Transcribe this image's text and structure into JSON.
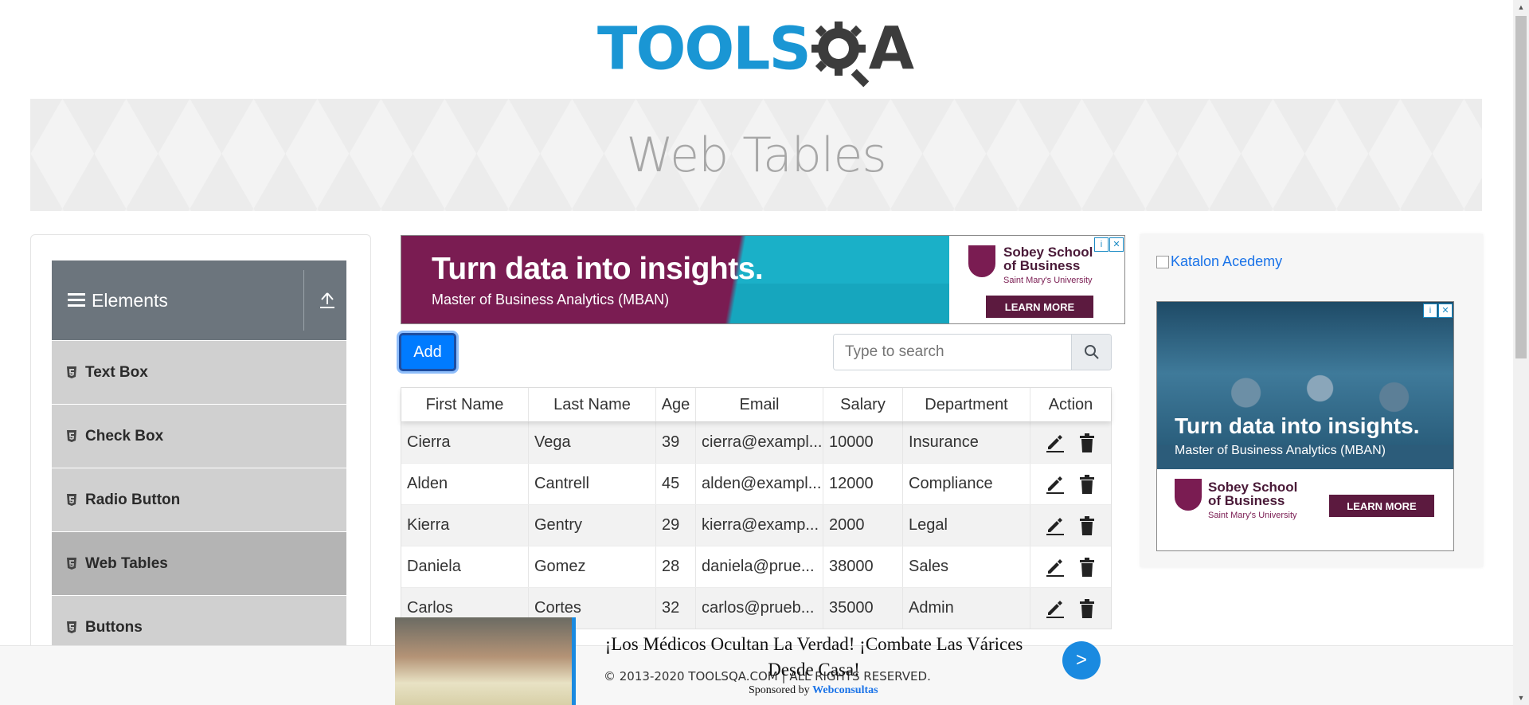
{
  "logo": {
    "part1": "TOOLS",
    "part2": "A"
  },
  "banner": {
    "title": "Web Tables"
  },
  "sidebar": {
    "group_title": "Elements",
    "items": [
      {
        "label": "Text Box"
      },
      {
        "label": "Check Box"
      },
      {
        "label": "Radio Button"
      },
      {
        "label": "Web Tables"
      },
      {
        "label": "Buttons"
      }
    ]
  },
  "ad_top": {
    "headline": "Turn data into insights.",
    "subline": "Master of Business Analytics (MBAN)",
    "brand_line1": "Sobey School",
    "brand_line2": "of Business",
    "brand_uni": "Saint Mary's University",
    "cta": "LEARN MORE"
  },
  "controls": {
    "add_label": "Add",
    "search_placeholder": "Type to search"
  },
  "table": {
    "headers": [
      "First Name",
      "Last Name",
      "Age",
      "Email",
      "Salary",
      "Department",
      "Action"
    ],
    "rows": [
      [
        "Cierra",
        "Vega",
        "39",
        "cierra@exampl...",
        "10000",
        "Insurance"
      ],
      [
        "Alden",
        "Cantrell",
        "45",
        "alden@exampl...",
        "12000",
        "Compliance"
      ],
      [
        "Kierra",
        "Gentry",
        "29",
        "kierra@examp...",
        "2000",
        "Legal"
      ],
      [
        "Daniela",
        "Gomez",
        "28",
        "daniela@prue...",
        "38000",
        "Sales"
      ],
      [
        "Carlos",
        "Cortes",
        "32",
        "carlos@prueb...",
        "35000",
        "Admin"
      ]
    ]
  },
  "right_panel": {
    "katalon_link": "Katalon Acedemy",
    "ad_headline": "Turn data into insights.",
    "ad_subline": "Master of Business Analytics (MBAN)",
    "brand_line1": "Sobey School",
    "brand_line2": "of Business",
    "brand_uni": "Saint Mary's University",
    "cta": "LEARN MORE"
  },
  "sticky_ad": {
    "title": "¡Los Médicos Ocultan La Verdad! ¡Combate Las Várices Desde Casa!",
    "go": ">",
    "sponsored_prefix": "Sponsored by",
    "sponsor": "Webconsultas"
  },
  "footer": {
    "text": "© 2013-2020 TOOLSQA.COM | ALL RIGHTS RESERVED."
  },
  "colors": {
    "primary": "#007bff",
    "logo_blue": "#1a96d4",
    "sidebar_header": "#6c757d",
    "active_item": "#b4b4b4"
  }
}
